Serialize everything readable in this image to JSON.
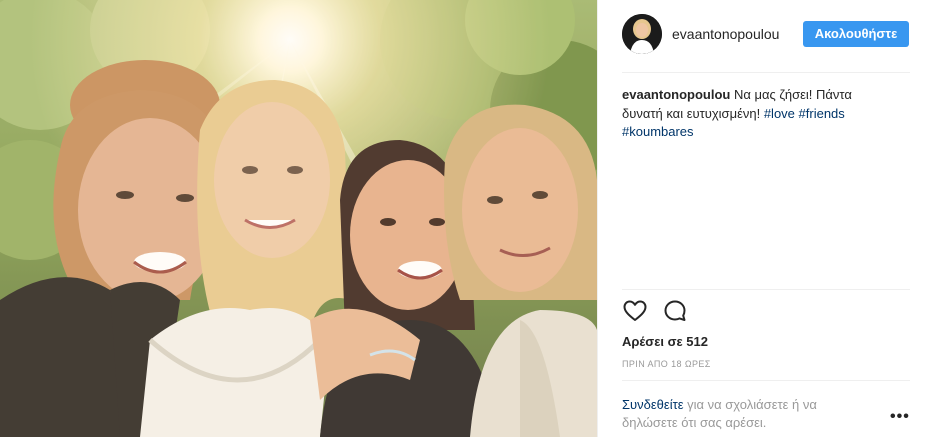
{
  "header": {
    "username": "evaantonopoulou",
    "follow_label": "Ακολουθήστε"
  },
  "caption": {
    "username": "evaantonopoulou",
    "text": " Να μας ζήσει! Πάντα δυνατή και ευτυχισμένη! ",
    "hashtags": [
      "#love",
      "#friends",
      "#koumbares"
    ]
  },
  "actions": {
    "like_icon": "heart-outline-icon",
    "comment_icon": "speech-bubble-icon"
  },
  "likes_text": "Αρέσει σε 512",
  "timestamp": "ΠΡΙΝ ΑΠΟ 18 ΩΡΕΣ",
  "login": {
    "link": "Συνδεθείτε",
    "rest": " για να σχολιάσετε ή να δηλώσετε ότι σας αρέσει."
  },
  "more_label": "•••",
  "colors": {
    "accent": "#3897f0",
    "hashtag": "#003569",
    "muted": "#999999",
    "text": "#262626"
  }
}
